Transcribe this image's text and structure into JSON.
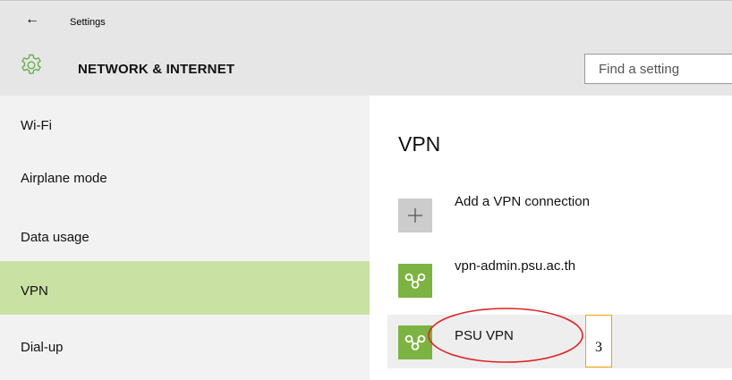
{
  "titlebar": {
    "title": "Settings",
    "back_icon": "←"
  },
  "header": {
    "title": "NETWORK & INTERNET",
    "search_placeholder": "Find a setting",
    "accent": "#6ab04c"
  },
  "sidebar": {
    "items": [
      {
        "label": "Wi-Fi",
        "selected": false
      },
      {
        "label": "Airplane mode",
        "selected": false
      },
      {
        "label": "Data usage",
        "selected": false
      },
      {
        "label": "VPN",
        "selected": true
      },
      {
        "label": "Dial-up",
        "selected": false
      }
    ],
    "selected_color": "#c9e2a3"
  },
  "main": {
    "section_title": "VPN",
    "add_connection": {
      "label": "Add a VPN connection",
      "icon": "plus-icon"
    },
    "connections": [
      {
        "label": "vpn-admin.psu.ac.th",
        "icon": "vpn-link-icon"
      },
      {
        "label": "PSU VPN",
        "icon": "vpn-link-icon"
      }
    ],
    "tile_color": "#7cb342"
  },
  "annotation": {
    "number": "3",
    "ellipse_color": "#e02020",
    "box_color": "#f4a300"
  }
}
